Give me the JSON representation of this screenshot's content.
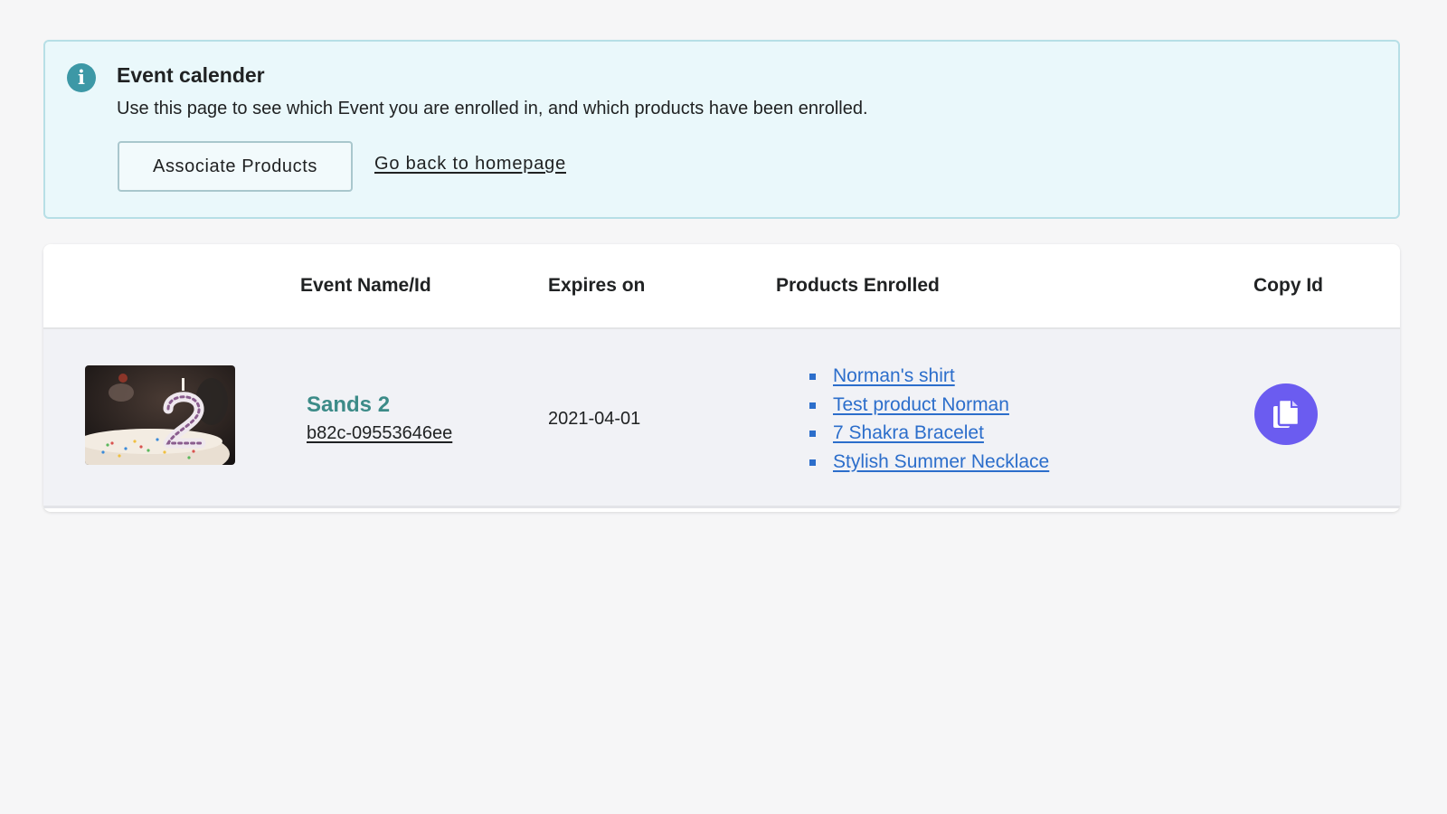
{
  "banner": {
    "icon": "info-icon",
    "icon_glyph": "i",
    "title": "Event calender",
    "description": "Use this page to see which Event you are enrolled in, and which products have been enrolled.",
    "associate_button": "Associate Products",
    "homepage_link": "Go back to homepage"
  },
  "table": {
    "headers": {
      "event": "Event Name/Id",
      "expires": "Expires on",
      "products": "Products Enrolled",
      "copy": "Copy Id"
    },
    "rows": [
      {
        "image": "birthday-cake-number-2-candle-thumbnail",
        "name": "Sands 2",
        "id": "b82c-09553646ee",
        "expires": "2021-04-01",
        "products": [
          "Norman's shirt",
          "Test product Norman",
          "7 Shakra Bracelet",
          "Stylish Summer Necklace"
        ],
        "copy_icon": "copy-icon"
      }
    ]
  },
  "colors": {
    "banner_background": "#eaf8fb",
    "banner_border": "#b7dfe6",
    "info_icon": "#3d98a6",
    "event_name": "#3c8b88",
    "link": "#2c6ecb",
    "copy_button": "#6b5cf0",
    "row_background": "#f1f2f6",
    "page_background": "#f6f6f7"
  }
}
